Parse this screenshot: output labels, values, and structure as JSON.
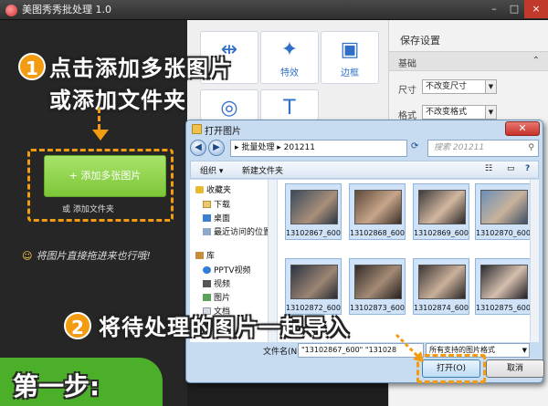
{
  "app": {
    "title": "美图秀秀批处理 1.0",
    "window_buttons": [
      "–",
      "□",
      "×"
    ]
  },
  "toolbox": {
    "items": [
      {
        "label": "",
        "icon": "resize-icon"
      },
      {
        "label": "特效",
        "icon": "magic-wand-icon"
      },
      {
        "label": "边框",
        "icon": "frame-icon"
      },
      {
        "label": "",
        "icon": "beautify-icon"
      },
      {
        "label": "",
        "icon": "text-icon"
      }
    ]
  },
  "settings": {
    "title": "保存设置",
    "section": "基础",
    "size_label": "尺寸",
    "size_value": "不改变尺寸",
    "format_label": "格式",
    "format_value": "不改变格式"
  },
  "left": {
    "add_button": "+ 添加多张图片",
    "add_folder": "或 添加文件夹",
    "drag_tip": "将图片直接拖进来也行哦!"
  },
  "dialog": {
    "title": "打开图片",
    "close": "✕",
    "breadcrumb": "▸  批量处理  ▸  201211",
    "search_placeholder": "搜索 201211",
    "cmd_organize": "组织 ▾",
    "cmd_new_folder": "新建文件夹",
    "nav": [
      {
        "label": "收藏夹",
        "icon": "favorites-icon"
      },
      {
        "label": "下载",
        "icon": "download-folder-icon"
      },
      {
        "label": "桌面",
        "icon": "desktop-icon"
      },
      {
        "label": "最近访问的位置",
        "icon": "recent-places-icon"
      },
      {
        "label": "库",
        "icon": "library-icon"
      },
      {
        "label": "PPTV视频",
        "icon": "pptv-icon"
      },
      {
        "label": "视频",
        "icon": "video-library-icon"
      },
      {
        "label": "图片",
        "icon": "pictures-library-icon"
      },
      {
        "label": "文档",
        "icon": "documents-library-icon"
      }
    ],
    "files": [
      "13102867_600",
      "13102868_600",
      "13102869_600",
      "13102870_600",
      "13102872_600",
      "13102873_600",
      "13102874_600",
      "13102875_600"
    ],
    "filename_label": "文件名(N):",
    "filename_value": "\"13102867_600\" \"131028",
    "filetype_value": "所有支持的图片格式",
    "open_button": "打开(O)",
    "cancel_button": "取消"
  },
  "overlay": {
    "step1_badge": "1",
    "step1_line1": "点击添加多张图片",
    "step1_line2": "或添加文件夹",
    "step2_badge": "2",
    "step2_text": "将待处理的图片一起导入",
    "banner": "第一步:"
  },
  "colors": {
    "accent_orange": "#f39c12",
    "add_button_green": "#7cc637",
    "banner_green": "#4caf2a"
  }
}
